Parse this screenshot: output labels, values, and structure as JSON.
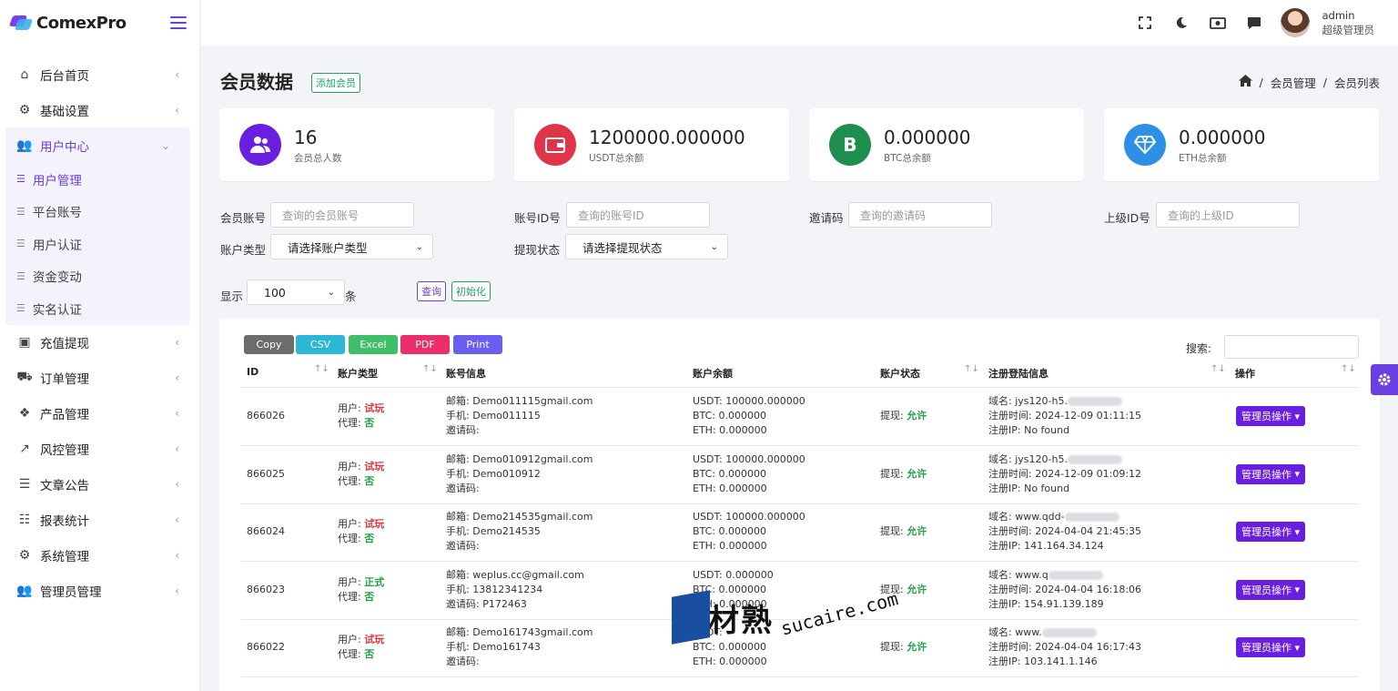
{
  "app": {
    "logo_text": "ComexPro"
  },
  "sidebar": {
    "items": [
      {
        "label": "后台首页",
        "icon": "home-icon",
        "glyph": "⌂"
      },
      {
        "label": "基础设置",
        "icon": "cogs-icon",
        "glyph": "⚙"
      },
      {
        "label": "用户中心",
        "icon": "users-icon",
        "glyph": "👥",
        "expanded": true,
        "children": [
          "用户管理",
          "平台账号",
          "用户认证",
          "资金变动",
          "实名认证"
        ]
      },
      {
        "label": "充值提现",
        "icon": "money-icon",
        "glyph": "▣"
      },
      {
        "label": "订单管理",
        "icon": "cart-icon",
        "glyph": "⛟"
      },
      {
        "label": "产品管理",
        "icon": "cubes-icon",
        "glyph": "❖"
      },
      {
        "label": "风控管理",
        "icon": "chart-line-icon",
        "glyph": "↗"
      },
      {
        "label": "文章公告",
        "icon": "layers-icon",
        "glyph": "☰"
      },
      {
        "label": "报表统计",
        "icon": "coins-icon",
        "glyph": "☷"
      },
      {
        "label": "系统管理",
        "icon": "gear-icon",
        "glyph": "⚙"
      },
      {
        "label": "管理员管理",
        "icon": "user-group-icon",
        "glyph": "👥"
      }
    ]
  },
  "header": {
    "user_name": "admin",
    "user_role": "超级管理员"
  },
  "page": {
    "title": "会员数据",
    "add_button": "添加会员",
    "breadcrumb": [
      "会员管理",
      "会员列表"
    ]
  },
  "stats": [
    {
      "value": "16",
      "label": "会员总人数",
      "color": "#6a1fe0",
      "icon": "users-icon"
    },
    {
      "value": "1200000.000000",
      "label": "USDT总余额",
      "color": "#e0344a",
      "icon": "wallet-icon"
    },
    {
      "value": "0.000000",
      "label": "BTC总余额",
      "color": "#1e8e4e",
      "icon": "bitcoin-icon",
      "glyph": "B"
    },
    {
      "value": "0.000000",
      "label": "ETH总余额",
      "color": "#2d8fe6",
      "icon": "diamond-icon"
    }
  ],
  "filters": {
    "account_label": "会员账号",
    "account_placeholder": "查询的会员账号",
    "id_label": "账号ID号",
    "id_placeholder": "查询的账号ID",
    "invite_label": "邀请码",
    "invite_placeholder": "查询的邀请码",
    "parent_label": "上级ID号",
    "parent_placeholder": "查询的上级ID",
    "type_label": "账户类型",
    "type_value": "请选择账户类型",
    "withdraw_label": "提现状态",
    "withdraw_value": "请选择提现状态",
    "show_label": "显示",
    "show_value": "100",
    "show_unit": "条",
    "query_button": "查询",
    "reset_button": "初始化"
  },
  "table": {
    "export_buttons": [
      {
        "label": "Copy",
        "color": "#6c6c6c"
      },
      {
        "label": "CSV",
        "color": "#2ab8d6"
      },
      {
        "label": "Excel",
        "color": "#3fbf6a"
      },
      {
        "label": "PDF",
        "color": "#ea2f6a"
      },
      {
        "label": "Print",
        "color": "#6a5ef0"
      }
    ],
    "search_label": "搜索:",
    "columns": [
      "ID",
      "账户类型",
      "账号信息",
      "账户余额",
      "账户状态",
      "注册登陆信息",
      "操作"
    ],
    "rows": [
      {
        "id": "866026",
        "user_type": "试玩",
        "user_type_class": "red",
        "agent": "否",
        "email": "Demo011115gmail.com",
        "phone": "Demo011115",
        "invite": "",
        "usdt": "100000.000000",
        "btc": "0.000000",
        "eth": "0.000000",
        "withdraw": "允许",
        "domain": "jys120-h5.",
        "reg_time": "2024-12-09 01:11:15",
        "reg_ip": "No found"
      },
      {
        "id": "866025",
        "user_type": "试玩",
        "user_type_class": "red",
        "agent": "否",
        "email": "Demo010912gmail.com",
        "phone": "Demo010912",
        "invite": "",
        "usdt": "100000.000000",
        "btc": "0.000000",
        "eth": "0.000000",
        "withdraw": "允许",
        "domain": "jys120-h5.",
        "reg_time": "2024-12-09 01:09:12",
        "reg_ip": "No found"
      },
      {
        "id": "866024",
        "user_type": "试玩",
        "user_type_class": "red",
        "agent": "否",
        "email": "Demo214535gmail.com",
        "phone": "Demo214535",
        "invite": "",
        "usdt": "100000.000000",
        "btc": "0.000000",
        "eth": "0.000000",
        "withdraw": "允许",
        "domain": "www.qdd-",
        "reg_time": "2024-04-04 21:45:35",
        "reg_ip": "141.164.34.124"
      },
      {
        "id": "866023",
        "user_type": "正式",
        "user_type_class": "green",
        "agent": "否",
        "email": "weplus.cc@gmail.com",
        "phone": "13812341234",
        "invite": "P172463",
        "usdt": "0.000000",
        "btc": "0.000000",
        "eth": "0.000000",
        "withdraw": "允许",
        "domain": "www.q",
        "reg_time": "2024-04-04 16:18:06",
        "reg_ip": "154.91.139.189"
      },
      {
        "id": "866022",
        "user_type": "试玩",
        "user_type_class": "red",
        "agent": "否",
        "email": "Demo161743gmail.com",
        "phone": "Demo161743",
        "invite": "",
        "usdt": "",
        "btc": "0.000000",
        "eth": "0.000000",
        "withdraw": "允许",
        "domain": "www.",
        "reg_time": "2024-04-04 16:17:43",
        "reg_ip": "103.141.1.146"
      }
    ],
    "labels": {
      "user": "用户:",
      "agent": "代理:",
      "email": "邮箱:",
      "phone": "手机:",
      "invite": "邀请码:",
      "usdt": "USDT:",
      "btc": "BTC:",
      "eth": "ETH:",
      "withdraw": "提现:",
      "domain": "域名:",
      "reg_time": "注册时间:",
      "reg_ip": "注册IP:"
    },
    "op_button": "管理员操作"
  },
  "watermark": {
    "cn": "素材熟",
    "en": "sucaire.com"
  }
}
